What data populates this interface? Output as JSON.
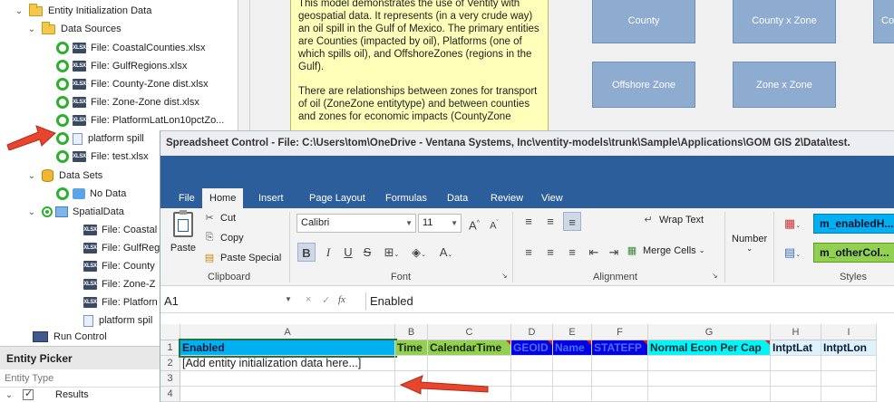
{
  "tree": {
    "items": [
      {
        "label": "Entity Initialization Data",
        "kind": "folder",
        "indent": 0,
        "chevron": "⌄"
      },
      {
        "label": "Data Sources",
        "kind": "folder",
        "indent": 1,
        "chevron": "⌄"
      },
      {
        "label": "File: CoastalCounties.xlsx",
        "kind": "xlsx"
      },
      {
        "label": "File: GulfRegions.xlsx",
        "kind": "xlsx"
      },
      {
        "label": "File: County-Zone dist.xlsx",
        "kind": "xlsx"
      },
      {
        "label": "File: Zone-Zone dist.xlsx",
        "kind": "xlsx"
      },
      {
        "label": "File: PlatformLatLon10pctZo...",
        "kind": "xlsx"
      },
      {
        "label": "platform spill",
        "kind": "doc"
      },
      {
        "label": "File: test.xlsx",
        "kind": "xlsx"
      },
      {
        "label": "Data Sets",
        "kind": "db"
      },
      {
        "label": "No Data",
        "kind": "nodata"
      },
      {
        "label": "SpatialData",
        "kind": "spatial"
      },
      {
        "label": "File: Coastal",
        "kind": "xlsx-sub"
      },
      {
        "label": "File: GulfReg",
        "kind": "xlsx-sub"
      },
      {
        "label": "File: County",
        "kind": "xlsx-sub"
      },
      {
        "label": "File: Zone-Z",
        "kind": "xlsx-sub"
      },
      {
        "label": "File: Platforn",
        "kind": "xlsx-sub"
      },
      {
        "label": "platform spil",
        "kind": "doc-sub"
      },
      {
        "label": "Run Control",
        "kind": "run"
      }
    ],
    "xlsx_badge": "XLSX"
  },
  "picker": {
    "title": "Entity Picker",
    "filter_placeholder": "Entity Type",
    "row_label": "Results"
  },
  "diagram": {
    "note_p1": "This model demonstrates the use of Ventity with geospatial data. It represents (in a very crude way) an oil spill in the Gulf of Mexico. The primary entities are Counties (impacted by oil), Platforms (one of which spills oil), and OffshoreZones (regions in the Gulf).",
    "note_p2": "There are relationships between zones for transport of oil (ZoneZone entitytype) and between counties and zones for economic impacts (CountyZone",
    "nodes": [
      "County",
      "County x Zone",
      "Coun",
      "Offshore Zone",
      "Zone x Zone"
    ]
  },
  "spreadsheet": {
    "title": "Spreadsheet Control - File: C:\\Users\\tom\\OneDrive - Ventana Systems, Inc\\ventity-models\\trunk\\Sample\\Applications\\GOM GIS 2\\Data\\test.",
    "tabs": [
      "File",
      "Home",
      "Insert",
      "Page Layout",
      "Formulas",
      "Data",
      "Review",
      "View"
    ],
    "active_tab": "Home",
    "clipboard": {
      "paste": "Paste",
      "cut": "Cut",
      "copy": "Copy",
      "paste_special": "Paste Special",
      "label": "Clipboard"
    },
    "font": {
      "name": "Calibri",
      "size": "11",
      "label": "Font"
    },
    "alignment": {
      "wrap": "Wrap Text",
      "merge": "Merge Cells",
      "label": "Alignment"
    },
    "number": {
      "label": "Number"
    },
    "styles": {
      "s1": "m_enabledH...",
      "s2": "m_otherCol...",
      "label": "Styles"
    },
    "name_box": "A1",
    "formula": "Enabled",
    "columns": [
      "A",
      "B",
      "C",
      "D",
      "E",
      "F",
      "G",
      "H",
      "I"
    ],
    "rows": [
      "1",
      "2",
      "3",
      "4"
    ],
    "header_cells": [
      "Enabled",
      "Time",
      "CalendarTime",
      "GEOID",
      "Name",
      "STATEFP",
      "Normal Econ Per Cap",
      "IntptLat",
      "IntptLon"
    ],
    "row2_a": "[Add entity initialization data here...]",
    "colors": {
      "enabled": "#00b0f0",
      "time_calendar": "#92d050",
      "geo_blue": "#0000e0",
      "normal_econ": "#00f5f5",
      "intpt": "#ddf3fb",
      "ribbon_blue": "#2c5e9b",
      "arrow_red": "#e8452e"
    }
  }
}
